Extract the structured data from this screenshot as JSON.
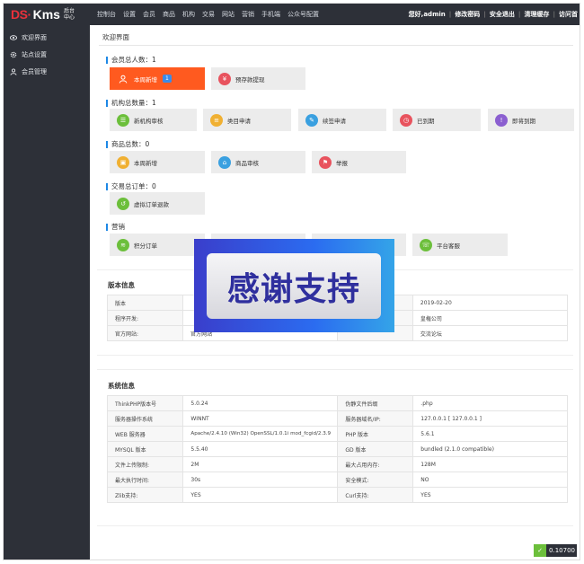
{
  "brand": {
    "ds": "DS·",
    "kms": "Kms",
    "sub": "后台中心"
  },
  "nav": [
    "控制台",
    "设置",
    "会员",
    "商品",
    "机构",
    "交易",
    "网站",
    "营销",
    "手机端",
    "公众号配置"
  ],
  "top_right": [
    "您好,admin",
    "修改密码",
    "安全退出",
    "清理缓存",
    "访问首"
  ],
  "sidebar": [
    {
      "icon": "eye-icon",
      "label": "欢迎界面"
    },
    {
      "icon": "gear-icon",
      "label": "站点设置"
    },
    {
      "icon": "user-icon",
      "label": "会员管理"
    }
  ],
  "page_title": "欢迎界面",
  "sections": {
    "members": {
      "title": "会员总人数：1",
      "cards": [
        {
          "label": "本周新增",
          "badge": "1",
          "color": "#ff5a1f"
        },
        {
          "label": "预存款提现",
          "color": "#e8535e"
        }
      ]
    },
    "orgs": {
      "title": "机构总数量：1",
      "cards": [
        {
          "label": "新机构审核",
          "color": "#6cbf3b"
        },
        {
          "label": "类目申请",
          "color": "#f0b032"
        },
        {
          "label": "续签申请",
          "color": "#3aa0e0"
        },
        {
          "label": "已到期",
          "color": "#e8535e"
        },
        {
          "label": "即将到期",
          "color": "#8b5fd0"
        }
      ]
    },
    "goods": {
      "title": "商品总数：0",
      "cards": [
        {
          "label": "本周新增",
          "color": "#f0b032"
        },
        {
          "label": "商品审核",
          "color": "#3aa0e0"
        },
        {
          "label": "举报",
          "color": "#e8535e"
        }
      ]
    },
    "orders": {
      "title": "交易总订单：0",
      "cards": [
        {
          "label": "虚拟订单退款",
          "color": "#6cbf3b"
        }
      ]
    },
    "marketing": {
      "title": "营销",
      "cards": [
        {
          "label": "积分订单",
          "color": "#6cbf3b"
        },
        {
          "label": "平台客服",
          "color": "#6cbf3b"
        }
      ]
    }
  },
  "version_panel": {
    "title": "版本信息",
    "rows": [
      [
        "版本",
        "",
        "",
        "2019-02-20"
      ],
      [
        "程序开发:",
        "",
        "",
        "皇権公司"
      ],
      [
        "官方网站:",
        "官方网站",
        "",
        "交流论坛"
      ]
    ]
  },
  "system_panel": {
    "title": "系统信息",
    "rows": [
      [
        "ThinkPHP版本号",
        "5.0.24",
        "伪静文件后缀",
        ".php"
      ],
      [
        "服务器操作系统",
        "WINNT",
        "服务器域名/IP:",
        "127.0.0.1 [ 127.0.0.1 ]"
      ],
      [
        "WEB 服务器",
        "Apache/2.4.10 (Win32) OpenSSL/1.0.1i mod_fcgid/2.3.9",
        "PHP 版本",
        "5.6.1"
      ],
      [
        "MYSQL 版本",
        "5.5.40",
        "GD 版本",
        "bundled (2.1.0 compatible)"
      ],
      [
        "文件上传限制:",
        "2M",
        "最大占用内存:",
        "128M"
      ],
      [
        "最大执行时间:",
        "30s",
        "安全模式:",
        "NO"
      ],
      [
        "Zlib支持:",
        "YES",
        "Curl支持:",
        "YES"
      ]
    ]
  },
  "overlay_text": "感谢支持",
  "footer_value": "0.10700"
}
